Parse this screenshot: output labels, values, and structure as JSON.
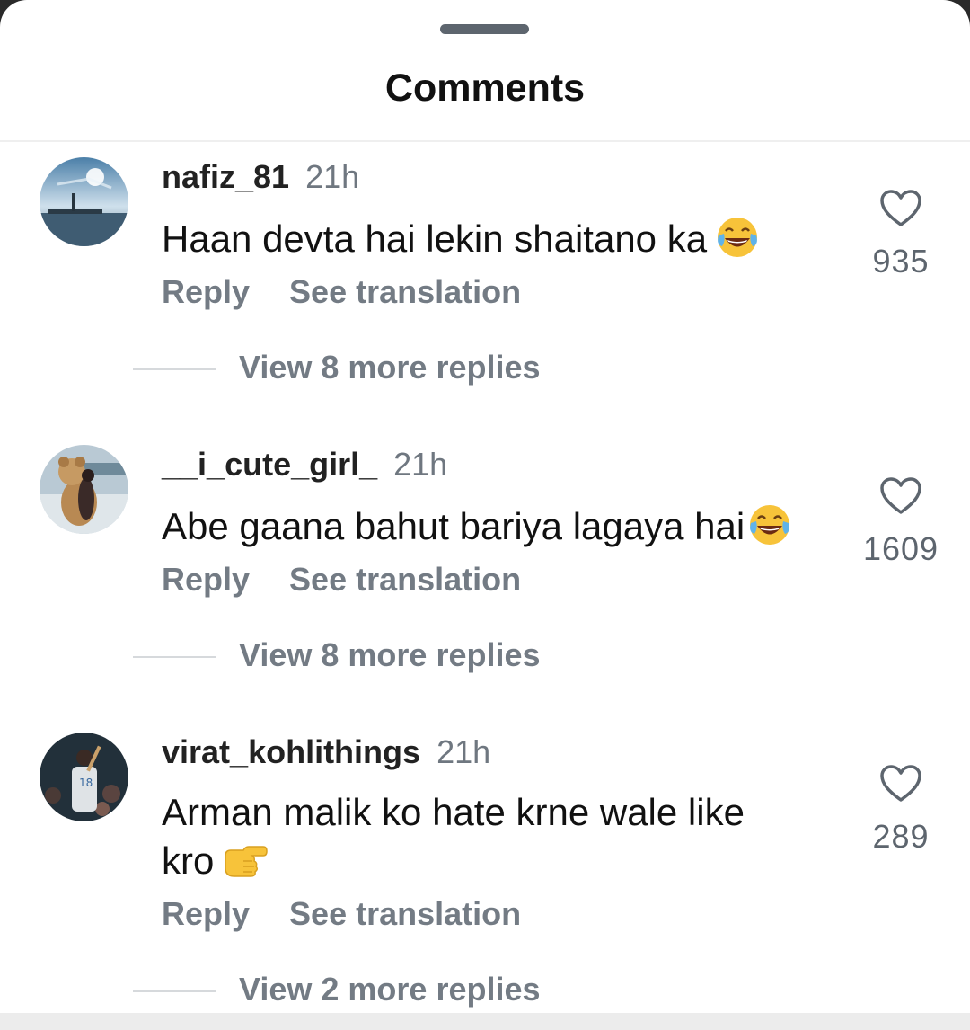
{
  "header": {
    "title": "Comments"
  },
  "comments": [
    {
      "username": "nafiz_81",
      "time": "21h",
      "text": "Haan devta hai lekin shaitano ka",
      "emoji": "face-with-tears-of-joy",
      "likes": "935",
      "reply_label": "Reply",
      "translate_label": "See translation",
      "view_replies": "View 8 more replies"
    },
    {
      "username": "__i_cute_girl_",
      "time": "21h",
      "text": "Abe gaana bahut bariya lagaya hai",
      "emoji": "face-with-tears-of-joy",
      "likes": "1609",
      "reply_label": "Reply",
      "translate_label": "See translation",
      "view_replies": "View 8 more replies"
    },
    {
      "username": "virat_kohlithings",
      "time": "21h",
      "text": "Arman malik ko hate krne wale like kro",
      "emoji": "pointing-right-hand",
      "likes": "289",
      "reply_label": "Reply",
      "translate_label": "See translation",
      "view_replies": "View 2 more replies"
    }
  ],
  "colors": {
    "username": "#222222",
    "muted": "#737b84",
    "handle": "#5d656e"
  }
}
